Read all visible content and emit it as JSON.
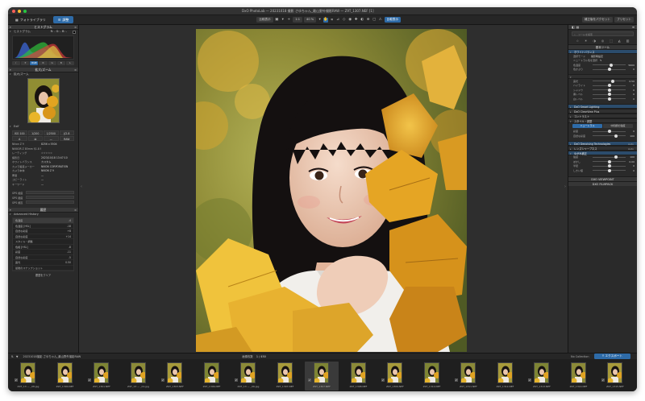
{
  "window": {
    "title": "DxO PhotoLab — 20231018 撮影 さゆちゃん_最山野外撮影RAW — Z9T_1307.NEF [1]"
  },
  "toolbar": {
    "tab_library": "フォトライブラリ",
    "tab_customize": "調整",
    "btn_compare": "比較表示",
    "btn_zoom_fit": "1:1",
    "btn_zoom_level": "40 %",
    "btn_compare_view": "比較表示",
    "btn_right_1": "補正版をパクセット",
    "btn_right_2": "プリセット"
  },
  "left_panel": {
    "histogram_header": "ヒストグラム",
    "histogram_sub": "ヒストグラム",
    "rgb_label": "R: - G: - B: -",
    "hist_buttons": [
      "RGB",
      "R",
      "G",
      "B",
      "L"
    ],
    "navigator_header": "拡大/ズーム",
    "navigator_sub": "拡大/ズーム",
    "exif_header": "Exif",
    "exif_cells": [
      "ISO 100",
      "1/200",
      "1/2500",
      "ƒ/2.8",
      "85 mm",
      "A",
      "⌘",
      "—",
      "RAW",
      "☰"
    ],
    "meta": [
      {
        "k": "Nikon Z 9",
        "v": "8256 x 5504"
      },
      {
        "k": "NIKKOR Z 85mm f/1.8 S",
        "v": ""
      },
      {
        "k": "レーティング",
        "v": "☆☆☆☆☆"
      },
      {
        "k": "撮影日",
        "v": "2023/10/18 13:47:10"
      },
      {
        "k": "ホワイトバランス",
        "v": "カスタム"
      },
      {
        "k": "カメラ製造メーカー",
        "v": "NIKON CORPORATION"
      },
      {
        "k": "カメラ本体",
        "v": "NIKON Z 9"
      },
      {
        "k": "著者",
        "v": "—"
      },
      {
        "k": "コピーライト",
        "v": "—"
      },
      {
        "k": "キーワード",
        "v": "—"
      }
    ],
    "gps": [
      "GPS 緯度",
      "GPS 経度",
      "GPS 標高"
    ],
    "history_header": "履歴",
    "history_sub": "Advanced History",
    "history_items": [
      {
        "name": "色温度",
        "value": "-4"
      },
      {
        "name": "色温度 [HSL]",
        "value": "-18"
      },
      {
        "name": "自然な彩度",
        "value": "+8"
      },
      {
        "name": "自然な彩度",
        "value": "+14"
      },
      {
        "name": "スタイル・調整",
        "value": ""
      },
      {
        "name": "色相 [HSL]",
        "value": "-8"
      },
      {
        "name": "彩度",
        "value": "-11"
      },
      {
        "name": "自然な彩度",
        "value": "-5"
      },
      {
        "name": "露光",
        "value": "0.50"
      },
      {
        "name": "最後のスナップショット",
        "value": ""
      }
    ],
    "history_footer": "履歴をクリア"
  },
  "right_panel": {
    "header": "基本ツール",
    "search_placeholder": "ツールを検索",
    "white_balance": "ホワイトバランス",
    "wb_mode_label": "選択モード",
    "wb_mode_value": "撮影時設定",
    "wb_picker_label": "ニュートラル色を選択",
    "wb_rows": [
      {
        "lbl": "色温度",
        "val": "5600",
        "pos": 0.55
      },
      {
        "lbl": "色かぶり",
        "val": "0",
        "pos": 0.5
      }
    ],
    "exposure_rows": [
      {
        "lbl": "露光",
        "val": "0.50",
        "pos": 0.62
      },
      {
        "lbl": "ハイライト",
        "val": "0",
        "pos": 0.5
      },
      {
        "lbl": "シャドウ",
        "val": "0",
        "pos": 0.5
      },
      {
        "lbl": "黒レベル",
        "val": "0",
        "pos": 0.5
      },
      {
        "lbl": "白レベル",
        "val": "0",
        "pos": 0.5
      }
    ],
    "smart_lighting": "DxO Smart Lighting",
    "clearview": "DxO ClearView Plus",
    "contrast": "コントラスト",
    "style": "スタイル・調整",
    "style_rows": [
      {
        "lbl": "スタイル",
        "val": "",
        "pos": 0.5
      }
    ],
    "style_btn_a": "ニュートラル",
    "style_btn_b": "中間調の強度",
    "color_rows": [
      {
        "lbl": "彩度",
        "val": "0",
        "pos": 0.5
      },
      {
        "lbl": "自然な彩度",
        "val": "100",
        "pos": 0.7
      }
    ],
    "noise": "DxO Denoising Technologies",
    "noise_mode": "Auto",
    "lens": "レンズシャープネス",
    "lens_value": "Auto",
    "distortion": "ゆがみ補正",
    "vignetting_rows": [
      {
        "lbl": "強度",
        "val": "100",
        "pos": 0.7
      },
      {
        "lbl": "ぼかし",
        "val": "0.00",
        "pos": 0.5
      },
      {
        "lbl": "半径",
        "val": "0",
        "pos": 0.5
      },
      {
        "lbl": "しきい値",
        "val": "0",
        "pos": 0.5
      }
    ],
    "viewpoint": "DXO VIEWPOINT",
    "filmpack": "DXO FILMPACK"
  },
  "filmbar": {
    "path": "20231018撮影 さゆちゃん_最山野外撮影RAW",
    "count_label": "画像枚数",
    "count_value": "1 / 450",
    "collection": "No Collection",
    "export": "エクスポート"
  },
  "filmstrip": [
    {
      "name": "Z9T_13 — _08.jpg",
      "sel": false
    },
    {
      "name": "Z9T_1300.NEF",
      "sel": false
    },
    {
      "name": "Z9T_1301.NEF",
      "sel": false
    },
    {
      "name": "Z9T_13 — _01.jpg",
      "sel": false
    },
    {
      "name": "Z9T_1303.NEF",
      "sel": false
    },
    {
      "name": "Z9T_1306.NEF",
      "sel": false
    },
    {
      "name": "Z9T_13 — _06.jpg",
      "sel": false
    },
    {
      "name": "Z9T_1307.NEF",
      "sel": false
    },
    {
      "name": "Z9T_1307.NEF",
      "sel": true
    },
    {
      "name": "Z9T_1308.NEF",
      "sel": false
    },
    {
      "name": "Z9T_1309.NEF",
      "sel": false
    },
    {
      "name": "Z9T_1310.NEF",
      "sel": false
    },
    {
      "name": "Z9T_1311.NEF",
      "sel": false
    },
    {
      "name": "Z9T_1312.NEF",
      "sel": false
    },
    {
      "name": "Z9T_1313.NEF",
      "sel": false
    },
    {
      "name": "Z9T_1314.NEF",
      "sel": false
    },
    {
      "name": "Z9T_1315.NEF",
      "sel": false
    }
  ],
  "colors": {
    "accent": "#2e6ba8",
    "panel": "#2a2a2a",
    "canvas": "#2e2e2e"
  }
}
